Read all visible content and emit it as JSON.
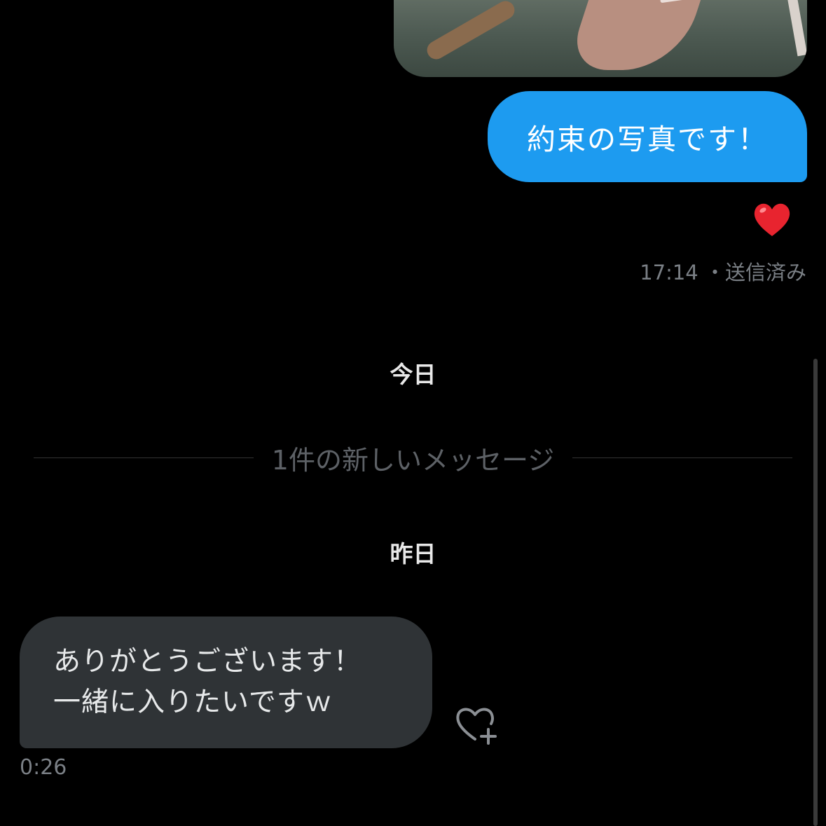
{
  "outgoing": {
    "text": "約束の写真です！",
    "time": "17:14",
    "status": "・送信済み",
    "reaction_icon": "red-heart-emoji",
    "photo_alt": "photo"
  },
  "date_today": "今日",
  "new_messages_divider": "1件の新しいメッセージ",
  "date_yesterday": "昨日",
  "incoming": {
    "line1": "ありがとうございます！",
    "line2": "一緒に入りたいですｗ",
    "time": "0:26",
    "reaction_button_icon": "heart-plus-icon"
  },
  "colors": {
    "outgoing_bubble": "#1d9bf0",
    "incoming_bubble": "#2f3336",
    "background": "#000000",
    "meta_text": "#7a7f85"
  }
}
